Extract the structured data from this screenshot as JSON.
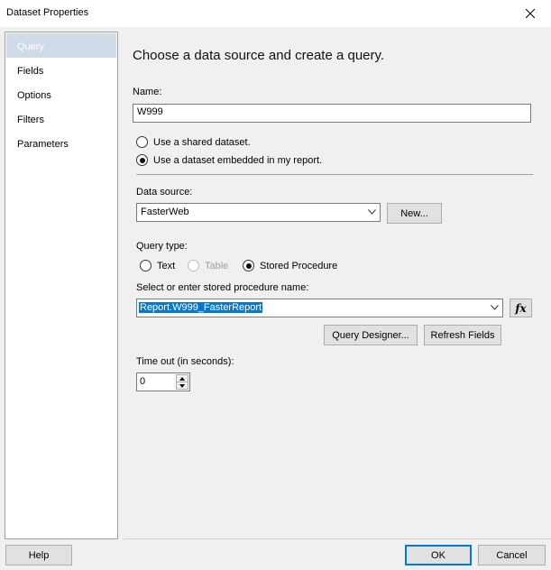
{
  "window": {
    "title": "Dataset Properties",
    "close_icon": "close-icon"
  },
  "nav": {
    "items": [
      {
        "label": "Query",
        "selected": true
      },
      {
        "label": "Fields",
        "selected": false
      },
      {
        "label": "Options",
        "selected": false
      },
      {
        "label": "Filters",
        "selected": false
      },
      {
        "label": "Parameters",
        "selected": false
      }
    ]
  },
  "main": {
    "heading": "Choose a data source and create a query.",
    "name_label": "Name:",
    "name_value": "W999",
    "radio_shared": "Use a shared dataset.",
    "radio_embedded": "Use a dataset embedded in my report.",
    "data_source_label": "Data source:",
    "data_source_value": "FasterWeb",
    "new_button": "New...",
    "query_type_label": "Query type:",
    "query_type_text": "Text",
    "query_type_table": "Table",
    "query_type_sp": "Stored Procedure",
    "sp_label": "Select or enter stored procedure name:",
    "sp_value": "Report.W999_FasterReport",
    "fx_label": "fx",
    "query_designer_button": "Query Designer...",
    "refresh_fields_button": "Refresh Fields",
    "timeout_label": "Time out (in seconds):",
    "timeout_value": "0"
  },
  "footer": {
    "help": "Help",
    "ok": "OK",
    "cancel": "Cancel"
  },
  "colors": {
    "accent": "#0078d7",
    "nav_selected": "#cfdbe6"
  }
}
